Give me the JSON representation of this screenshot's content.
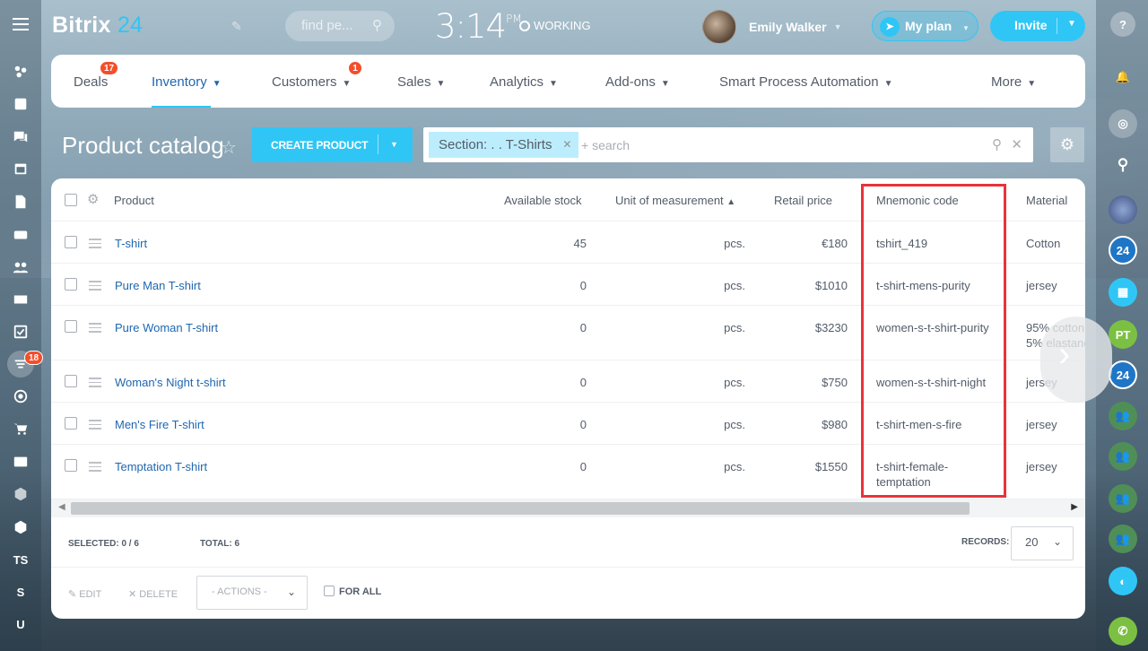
{
  "header": {
    "logo_main": "Bitrix",
    "logo_num": "24",
    "search_placeholder": "find pe...",
    "clock_time": "3:14",
    "clock_ampm": "PM",
    "status": "WORKING",
    "user_name": "Emily Walker",
    "myplan_label": "My plan",
    "invite_label": "Invite"
  },
  "left_sidebar": {
    "badge_count": "18",
    "text_items": [
      "TS",
      "S",
      "U"
    ]
  },
  "right_sidebar": {
    "badge_24_a": "24",
    "badge_24_b": "24",
    "initials": "PT"
  },
  "nav": {
    "items": [
      {
        "label": "Deals",
        "badge": "17"
      },
      {
        "label": "Inventory"
      },
      {
        "label": "Customers",
        "badge": "1"
      },
      {
        "label": "Sales"
      },
      {
        "label": "Analytics"
      },
      {
        "label": "Add-ons"
      },
      {
        "label": "Smart Process Automation"
      },
      {
        "label": "More"
      }
    ]
  },
  "page": {
    "title": "Product catalog",
    "create_label": "CREATE PRODUCT",
    "filter_chip": "Section: . . T-Shirts",
    "filter_placeholder": "+ search"
  },
  "table": {
    "headers": {
      "product": "Product",
      "stock": "Available stock",
      "unit": "Unit of measurement",
      "price": "Retail price",
      "mnemonic": "Mnemonic code",
      "material": "Material"
    },
    "rows": [
      {
        "name": "T-shirt",
        "stock": "45",
        "unit": "pcs.",
        "price": "€180",
        "code": "tshirt_419",
        "material": "Cotton"
      },
      {
        "name": "Pure Man T-shirt",
        "stock": "0",
        "unit": "pcs.",
        "price": "$1010",
        "code": "t-shirt-mens-purity",
        "material": "jersey"
      },
      {
        "name": "Pure Woman T-shirt",
        "stock": "0",
        "unit": "pcs.",
        "price": "$3230",
        "code": "women-s-t-shirt-purity",
        "material": "95% cotton",
        "material2": "5% elastane"
      },
      {
        "name": "Woman's Night t-shirt",
        "stock": "0",
        "unit": "pcs.",
        "price": "$750",
        "code": "women-s-t-shirt-night",
        "material": "jersey"
      },
      {
        "name": "Men's Fire T-shirt",
        "stock": "0",
        "unit": "pcs.",
        "price": "$980",
        "code": "t-shirt-men-s-fire",
        "material": "jersey"
      },
      {
        "name": "Temptation T-shirt",
        "stock": "0",
        "unit": "pcs.",
        "price": "$1550",
        "code": "t-shirt-female-",
        "code2": "temptation",
        "material": "jersey"
      }
    ]
  },
  "footer": {
    "selected_label": "SELECTED: 0 / 6",
    "total_label": "TOTAL: 6",
    "records_label": "RECORDS:",
    "records_value": "20",
    "edit_label": "EDIT",
    "delete_label": "DELETE",
    "actions_label": "- ACTIONS -",
    "forall_label": "FOR ALL"
  }
}
